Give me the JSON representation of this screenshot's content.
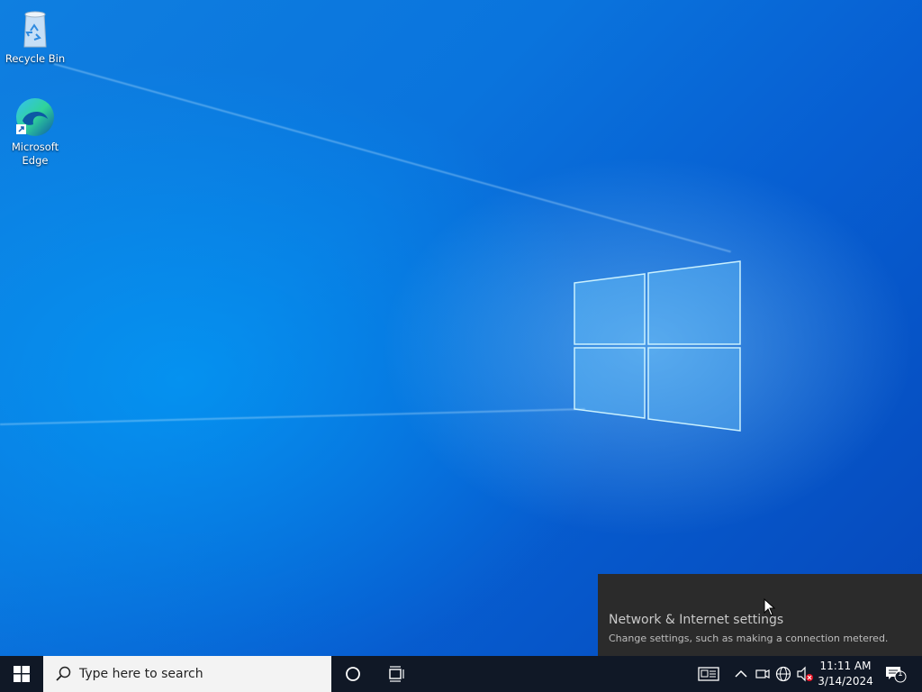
{
  "desktop": {
    "icons": [
      {
        "label": "Recycle Bin",
        "icon": "recycle-bin-icon"
      },
      {
        "label": "Microsoft\nEdge",
        "icon": "edge-icon"
      }
    ]
  },
  "toast": {
    "title": "Network & Internet settings",
    "description": "Change settings, such as making a connection metered."
  },
  "taskbar": {
    "search_placeholder": "Type here to search",
    "clock_time": "11:11 AM",
    "clock_date": "3/14/2024",
    "notification_count": "1"
  },
  "colors": {
    "taskbar_bg": "#101826",
    "toast_bg": "#2b2b2b",
    "desktop_accent": "#0a74dd"
  }
}
